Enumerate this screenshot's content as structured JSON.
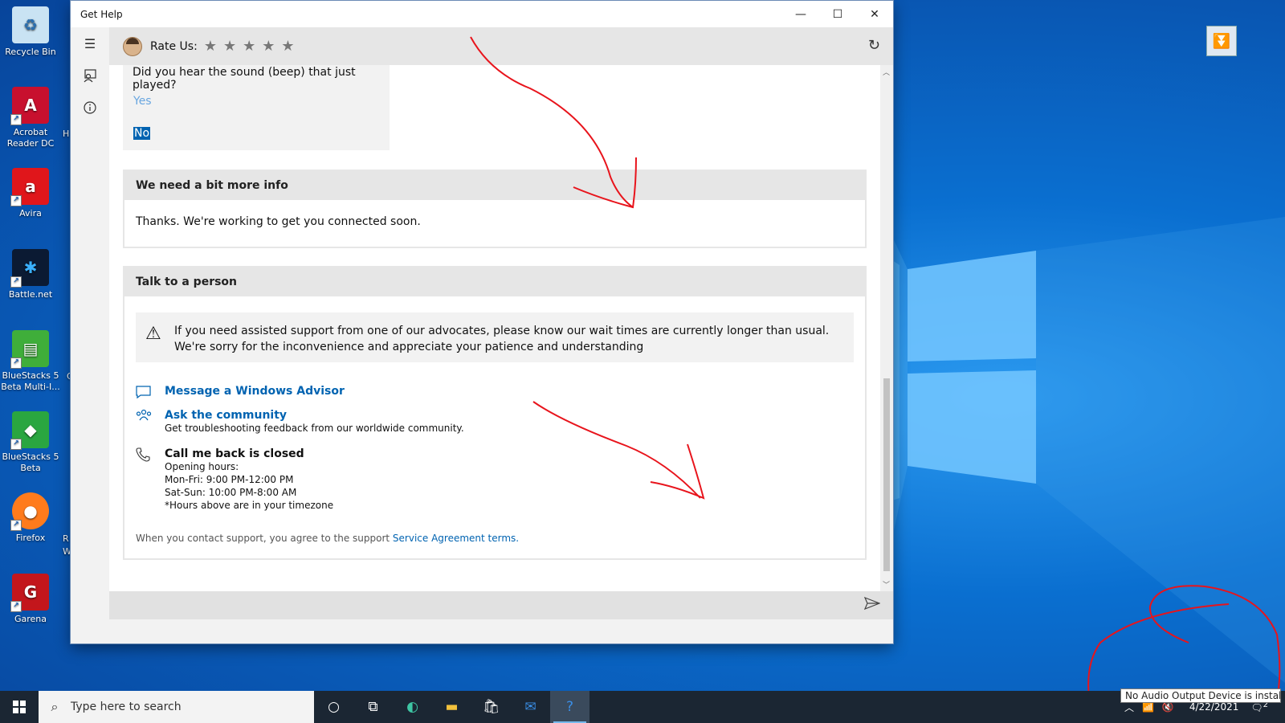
{
  "desktop": {
    "icons": [
      {
        "label": "Recycle Bin",
        "color": "#9ec9e8",
        "glyph": "♻"
      },
      {
        "label": "Acrobat Reader DC",
        "color": "#c8102e",
        "glyph": "A"
      },
      {
        "label": "Avira",
        "color": "#e0161b",
        "glyph": "a"
      },
      {
        "label": "Battle.net",
        "color": "#0b1a33",
        "glyph": "✱"
      },
      {
        "label": "BlueStacks 5 Beta Multi-I...",
        "color": "#3fae3a",
        "glyph": "▤"
      },
      {
        "label": "BlueStacks 5 Beta",
        "color": "#2aa640",
        "glyph": "◆"
      },
      {
        "label": "Firefox",
        "color": "#ff7b1c",
        "glyph": "●"
      },
      {
        "label": "Garena",
        "color": "#c3161c",
        "glyph": "G"
      }
    ],
    "partial_labels": [
      "H",
      "C",
      "R",
      "W"
    ]
  },
  "window": {
    "title": "Get Help",
    "controls": {
      "minimize": "—",
      "maximize": "☐",
      "close": "✕"
    }
  },
  "topbar": {
    "rate_label": "Rate Us:",
    "stars": [
      "★",
      "★",
      "★",
      "★",
      "★"
    ],
    "rating_filled": 0
  },
  "question": {
    "text": "Did you hear the sound (beep) that just played?",
    "option_yes": "Yes",
    "option_no": "No",
    "selected": "No"
  },
  "info_card": {
    "title": "We need a bit more info",
    "body": "Thanks. We're working to get you connected soon."
  },
  "person_card": {
    "title": "Talk to a person",
    "warning": "If you need assisted support from one of our advocates, please know our wait times are currently longer than usual. We're sorry for the inconvenience and appreciate your patience and understanding",
    "message_advisor": "Message a Windows Advisor",
    "community_title": "Ask the community",
    "community_sub": "Get troubleshooting feedback from our worldwide community.",
    "callback_title": "Call me back is closed",
    "callback_lines": [
      "Opening hours:",
      "Mon-Fri: 9:00 PM-12:00 PM",
      "Sat-Sun: 10:00 PM-8:00 AM",
      "*Hours above are in your timezone"
    ],
    "terms_prefix": "When you contact support, you agree to the support ",
    "terms_link": "Service Agreement terms."
  },
  "taskbar": {
    "search_placeholder": "Type here to search",
    "date": "4/22/2021",
    "tooltip": "No Audio Output Device is installed.",
    "notification_count": "2"
  },
  "colors": {
    "accent": "#0063b1",
    "annotation": "#e8141c"
  }
}
